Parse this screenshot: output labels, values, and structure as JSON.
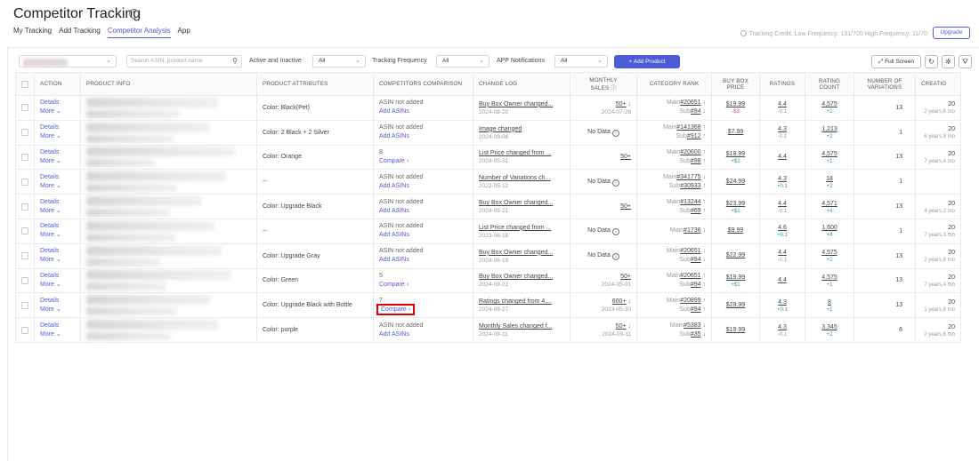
{
  "header": {
    "title": "Competitor Tracking",
    "tabs": [
      "My Tracking",
      "Add Tracking",
      "Competitor Analysis",
      "App"
    ],
    "active_tab": 2,
    "credit": "Tracking Credit: Low Frequency: 131/700 High Frequency: 11/70",
    "upgrade": "Upgrade"
  },
  "filters": {
    "search_placeholder": "Search ASIN, product name",
    "active_label": "Active and Inactive",
    "active_value": "All",
    "freq_label": "Tracking Frequency",
    "freq_value": "All",
    "notif_label": "APP Notifications",
    "notif_value": "All",
    "add_product": "+ Add Product",
    "full_screen": "Full Screen"
  },
  "columns": {
    "action": "ACTION",
    "product_info": "PRODUCT INFO",
    "attributes": "PRODUCT ATTRIBUTES",
    "comparison": "COMPETITORS COMPARISON",
    "change_log": "CHANGE LOG",
    "monthly_sales_1": "MONTHLY",
    "monthly_sales_2": "SALES",
    "category_rank": "CATEGORY RANK",
    "buybox_1": "BUY BOX",
    "buybox_2": "PRICE",
    "ratings": "RATINGS",
    "rating_count_1": "RATING",
    "rating_count_2": "COUNT",
    "variations_1": "NUMBER OF",
    "variations_2": "VARIATIONS",
    "created": "CREATIO"
  },
  "row_actions": {
    "details": "Details",
    "more": "More"
  },
  "rows": [
    {
      "attr": "Color: Black(Pet)",
      "cmp1": "ASIN not added",
      "cmp2": "Add ASINs",
      "log": "Buy Box Owner changed...",
      "log_date": "2024-08-20",
      "sales": "50+",
      "sales_trend": "↓",
      "sales_date": "2024-07-28",
      "rank1": "#20651",
      "rank1_trend": "↓",
      "rank2": "#94",
      "rank2_trend": "↓",
      "price": "$19.99",
      "price_delta": "-$3",
      "rating": "4.4",
      "rating_delta": "-0.1",
      "count": "4,575",
      "count_delta": "+2",
      "variations": "13",
      "created1": "20",
      "created2": "2 years,6 mo"
    },
    {
      "attr": "Color: 2 Black + 2 Silver",
      "cmp1": "ASIN not added",
      "cmp2": "Add ASINs",
      "log": "Image changed",
      "log_date": "2024-09-06",
      "sales": "No Data",
      "sales_trend": "",
      "sales_date": "",
      "rank1": "#141368",
      "rank1_trend": "↑",
      "rank2": "#912",
      "rank2_trend": "↑",
      "price": "$7.99",
      "price_delta": "",
      "rating": "4.3",
      "rating_delta": "-0.1",
      "count": "1,213",
      "count_delta": "+2",
      "variations": "1",
      "created1": "20",
      "created2": "6 years,9 mo"
    },
    {
      "attr": "Color: Orange",
      "cmp1": "8",
      "cmp2": "Compare",
      "log": "List Price changed from ...",
      "log_date": "2024-05-31",
      "sales": "50+",
      "sales_trend": "",
      "sales_date": "",
      "rank1": "#20600",
      "rank1_trend": "↑",
      "rank2": "#98",
      "rank2_trend": "↑",
      "price": "$18.99",
      "price_delta": "+$2",
      "rating": "4.4",
      "rating_delta": "",
      "count": "4,575",
      "count_delta": "+1",
      "variations": "13",
      "created1": "20",
      "created2": "7 years,4 mo"
    },
    {
      "attr": "--",
      "cmp1": "ASIN not added",
      "cmp2": "Add ASINs",
      "log": "Number of Variations ch...",
      "log_date": "2022-05-12",
      "sales": "No Data",
      "sales_trend": "",
      "sales_date": "",
      "rank1": "#341775",
      "rank1_trend": "↓",
      "rank2": "#30933",
      "rank2_trend": "↑",
      "price": "$24.99",
      "price_delta": "",
      "rating": "4.3",
      "rating_delta": "+0.1",
      "count": "18",
      "count_delta": "+2",
      "variations": "1",
      "created1": "",
      "created2": ""
    },
    {
      "attr": "Color: Upgrade Black",
      "cmp1": "ASIN not added",
      "cmp2": "Add ASINs",
      "log": "Buy Box Owner changed...",
      "log_date": "2024-09-21",
      "sales": "50+",
      "sales_trend": "",
      "sales_date": "",
      "rank1": "#13244",
      "rank1_trend": "↑",
      "rank2": "#69",
      "rank2_trend": "↑",
      "price": "$23.99",
      "price_delta": "+$1",
      "rating": "4.4",
      "rating_delta": "-0.1",
      "count": "4,571",
      "count_delta": "+4",
      "variations": "13",
      "created1": "20",
      "created2": "4 years,2 mo"
    },
    {
      "attr": "--",
      "cmp1": "ASIN not added",
      "cmp2": "Add ASINs",
      "log": "List Price changed from ...",
      "log_date": "2023-06-18",
      "sales": "No Data",
      "sales_trend": "",
      "sales_date": "",
      "rank1": "#1736",
      "rank1_trend": "↓",
      "rank2": "",
      "rank2_trend": "",
      "price": "$9.99",
      "price_delta": "",
      "rating": "4.6",
      "rating_delta": "+0.1",
      "count": "1,600",
      "count_delta": "+4",
      "variations": "1",
      "created1": "20",
      "created2": "7 years,3 mo"
    },
    {
      "attr": "Color: Upgrade Gray",
      "cmp1": "ASIN not added",
      "cmp2": "Add ASINs",
      "log": "Buy Box Owner changed...",
      "log_date": "2024-06-19",
      "sales": "No Data",
      "sales_trend": "",
      "sales_date": "",
      "rank1": "#20651",
      "rank1_trend": "↓",
      "rank2": "#94",
      "rank2_trend": "↓",
      "price": "$22.99",
      "price_delta": "",
      "rating": "4.4",
      "rating_delta": "-0.1",
      "count": "4,575",
      "count_delta": "+2",
      "variations": "13",
      "created1": "20",
      "created2": "2 years,6 mo"
    },
    {
      "attr": "Color: Green",
      "cmp1": "5",
      "cmp2": "Compare",
      "log": "Buy Box Owner changed...",
      "log_date": "2024-09-21",
      "sales": "50+",
      "sales_trend": "",
      "sales_date": "2024-05-01",
      "rank1": "#20651",
      "rank1_trend": "↑",
      "rank2": "#94",
      "rank2_trend": "↑",
      "price": "$19.99",
      "price_delta": "+$1",
      "rating": "4.4",
      "rating_delta": "",
      "count": "4,575",
      "count_delta": "+1",
      "variations": "13",
      "created1": "20",
      "created2": "7 years,4 mo"
    },
    {
      "attr": "Color: Upgrade Black with Bottle",
      "cmp1": "7",
      "cmp2": "Compare",
      "log": "Ratings changed from 4....",
      "log_date": "2024-09-27",
      "sales": "600+",
      "sales_trend": "↓",
      "sales_date": "2023-05-30",
      "rank1": "#20899",
      "rank1_trend": "↑",
      "rank2": "#94",
      "rank2_trend": "↑",
      "price": "$29.99",
      "price_delta": "",
      "rating": "4.3",
      "rating_delta": "+0.1",
      "count": "8",
      "count_delta": "+1",
      "variations": "13",
      "created1": "20",
      "created2": "1 years,6 mo"
    },
    {
      "attr": "Color: purple",
      "cmp1": "ASIN not added",
      "cmp2": "Add ASINs",
      "log": "Monthly Sales changed f...",
      "log_date": "2024-09-11",
      "sales": "50+",
      "sales_trend": "↓",
      "sales_date": "2024-09-11",
      "rank1": "#5383",
      "rank1_trend": "↓",
      "rank2": "#35",
      "rank2_trend": "↓",
      "price": "$19.99",
      "price_delta": "",
      "rating": "4.3",
      "rating_delta": "-0.1",
      "count": "3,345",
      "count_delta": "+2",
      "variations": "6",
      "created1": "20",
      "created2": "2 years,6 mo"
    }
  ],
  "labels": {
    "main": "Main",
    "sub": "Sub"
  },
  "colors": {
    "accent": "#4e5bd8",
    "up": "#2fa84f",
    "down": "#e04848",
    "highlight": "#e00000"
  }
}
